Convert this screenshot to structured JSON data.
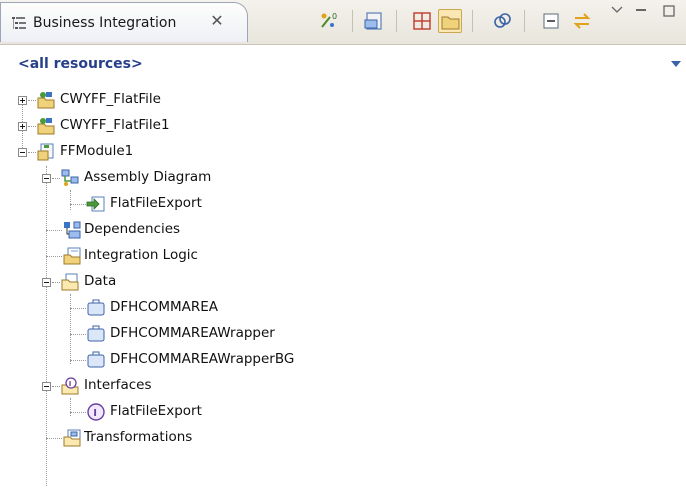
{
  "view": {
    "tab_label": "Business Integration",
    "tab_close": "✕",
    "filter_label": "<all resources>"
  },
  "toolbar": [
    {
      "name": "show-files-icon"
    },
    {
      "name": "open-module-icon"
    },
    {
      "name": "grid-icon"
    },
    {
      "name": "folder-icon",
      "pressed": true
    },
    {
      "name": "link-icon"
    },
    {
      "name": "collapse-all-icon"
    },
    {
      "name": "sync-icon"
    }
  ],
  "tree": {
    "items": [
      {
        "label": "CWYFF_FlatFile"
      },
      {
        "label": "CWYFF_FlatFile1"
      },
      {
        "label": "FFModule1"
      },
      {
        "label": "Assembly Diagram"
      },
      {
        "label": "FlatFileExport"
      },
      {
        "label": "Dependencies"
      },
      {
        "label": "Integration Logic"
      },
      {
        "label": "Data"
      },
      {
        "label": "DFHCOMMAREA"
      },
      {
        "label": "DFHCOMMAREAWrapper"
      },
      {
        "label": "DFHCOMMAREAWrapperBG"
      },
      {
        "label": "Interfaces"
      },
      {
        "label": "FlatFileExport"
      },
      {
        "label": "Transformations"
      }
    ]
  },
  "colors": {
    "filter_text": "#253f8a",
    "interface_icon": "#6b3fa0",
    "folder": "#f0d27a"
  }
}
